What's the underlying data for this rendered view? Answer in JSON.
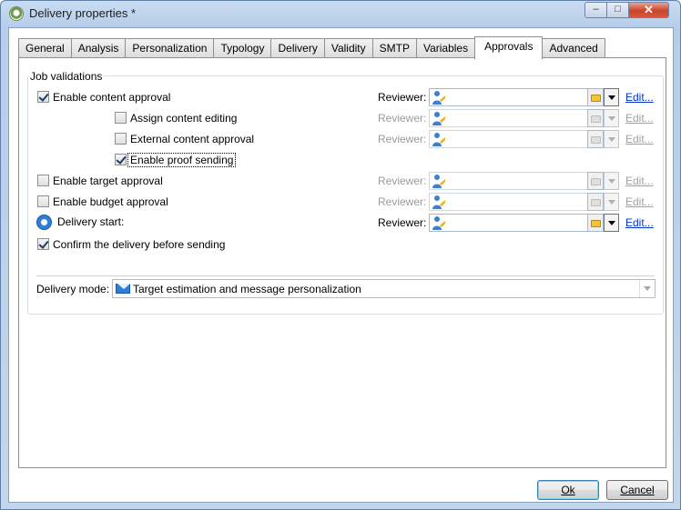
{
  "window": {
    "title": "Delivery properties *",
    "controls": {
      "minimize": "–",
      "maximize": "□",
      "close": "✕"
    }
  },
  "tabs": [
    "General",
    "Analysis",
    "Personalization",
    "Typology",
    "Delivery",
    "Validity",
    "SMTP",
    "Variables",
    "Approvals",
    "Advanced"
  ],
  "active_tab": "Approvals",
  "job_validations": {
    "legend": "Job validations",
    "reviewer_label": "Reviewer:",
    "edit_label": "Edit...",
    "rows": [
      {
        "label": "Enable content approval",
        "checked": true,
        "enabled": true
      },
      {
        "label": "Assign content editing",
        "checked": false,
        "enabled": false
      },
      {
        "label": "External content approval",
        "checked": false,
        "enabled": false
      },
      {
        "label": "Enable proof sending",
        "checked": true,
        "enabled": false
      },
      {
        "label": "Enable target approval",
        "checked": false,
        "enabled": false
      },
      {
        "label": "Enable budget approval",
        "checked": false,
        "enabled": false
      },
      {
        "label": "Delivery start:",
        "checked": null,
        "enabled": true
      }
    ],
    "confirm_label": "Confirm the delivery before sending",
    "confirm_checked": true,
    "delivery_mode_label": "Delivery mode:",
    "delivery_mode_value": "Target estimation and message personalization"
  },
  "buttons": {
    "ok": "Ok",
    "cancel": "Cancel"
  },
  "colors": {
    "link": "#0033cc",
    "disabled_text": "#9a9a9a",
    "title_bar": "#b7cde9"
  }
}
